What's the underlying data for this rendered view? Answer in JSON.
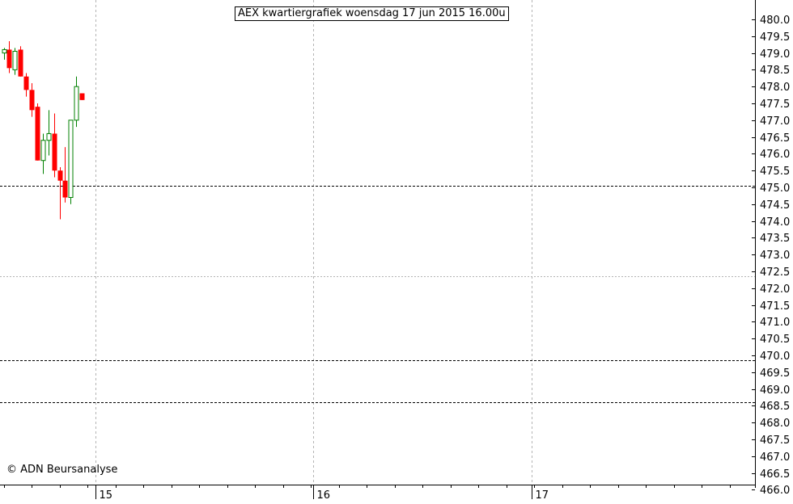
{
  "chart_data": {
    "type": "candlestick",
    "title": "AEX kwartiergrafiek woensdag 17 jun 2015 16.00u",
    "copyright": "© ADN Beursanalyse",
    "ylim": [
      465.75,
      480.4
    ],
    "y_ticks": [
      "480.0",
      "479.5",
      "479.0",
      "478.5",
      "478.0",
      "477.5",
      "477.0",
      "476.5",
      "476.0",
      "475.5",
      "475.0",
      "474.5",
      "474.0",
      "473.5",
      "473.0",
      "472.5",
      "472.0",
      "471.5",
      "471.0",
      "470.5",
      "470.0",
      "469.5",
      "469.0",
      "468.5",
      "468.0",
      "467.5",
      "467.0",
      "466.5",
      "466.0"
    ],
    "days": [
      {
        "label": "15",
        "start_index": 17
      },
      {
        "label": "16",
        "start_index": 56
      },
      {
        "label": "17",
        "start_index": 95
      }
    ],
    "reference_lines": [
      {
        "value": 475.05,
        "style": "dashed"
      },
      {
        "value": 469.85,
        "style": "dashed"
      },
      {
        "value": 468.6,
        "style": "dashed"
      },
      {
        "value": 472.35,
        "style": "dotted"
      }
    ],
    "colors": {
      "up": "#008000",
      "down": "#ff0000",
      "grid": "#b4b4b4",
      "reference": "#000000"
    },
    "candles": [
      [
        479.0,
        479.15,
        478.8,
        479.1
      ],
      [
        479.1,
        479.35,
        478.4,
        478.55
      ],
      [
        478.5,
        479.15,
        478.35,
        479.05
      ],
      [
        479.1,
        479.2,
        478.3,
        478.3
      ],
      [
        478.3,
        478.4,
        477.7,
        477.9
      ],
      [
        477.9,
        478.1,
        477.1,
        477.3
      ],
      [
        477.4,
        477.5,
        475.8,
        475.8
      ],
      [
        475.8,
        476.6,
        475.4,
        476.4
      ],
      [
        476.4,
        477.3,
        475.95,
        476.6
      ],
      [
        476.6,
        477.2,
        475.3,
        475.5
      ],
      [
        475.5,
        475.6,
        474.05,
        475.2
      ],
      [
        475.2,
        476.2,
        474.55,
        474.7
      ],
      [
        474.7,
        477.0,
        474.5,
        477.0
      ],
      [
        477.0,
        478.3,
        476.8,
        478.0
      ],
      [
        477.8,
        477.8,
        477.6,
        477.6
      ]
    ]
  }
}
